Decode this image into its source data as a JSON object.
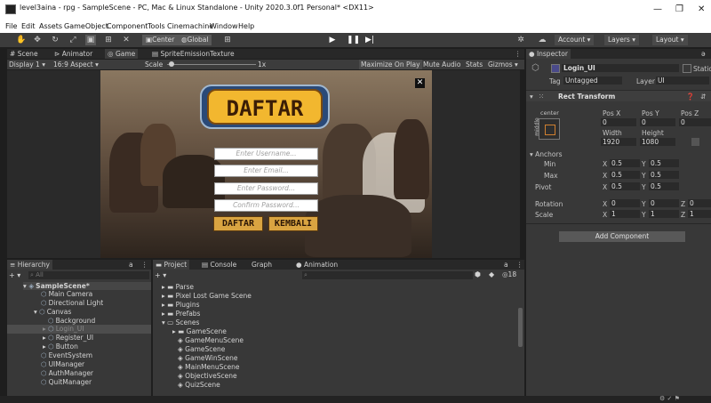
{
  "window": {
    "title": "level3aina - rpg - SampleScene - PC, Mac & Linux Standalone - Unity 2020.3.0f1 Personal* <DX11>",
    "minimize": "—",
    "maximize": "❐",
    "close": "✕"
  },
  "menu": [
    "File",
    "Edit",
    "Assets",
    "GameObject",
    "Component",
    "Tools",
    "Cinemachine",
    "Window",
    "Help"
  ],
  "toolbar": {
    "center_label": "Center",
    "global_label": "Global",
    "account_label": "Account",
    "layers_label": "Layers",
    "layout_label": "Layout"
  },
  "scene_tabs": {
    "scene": "Scene",
    "animator": "Animator",
    "game": "Game",
    "sprite_emission": "SpriteEmissionTexture"
  },
  "game_bar": {
    "display": "Display 1",
    "aspect": "16:9 Aspect",
    "scale_label": "Scale",
    "scale_value": "1x",
    "maximize": "Maximize On Play",
    "mute": "Mute Audio",
    "stats": "Stats",
    "gizmos": "Gizmos"
  },
  "game_ui": {
    "logo_text": "DAFTAR",
    "username_placeholder": "Enter Username...",
    "email_placeholder": "Enter Email...",
    "password_placeholder": "Enter Password...",
    "confirm_placeholder": "Confirm Password...",
    "daftar_button": "DAFTAR",
    "kembali_button": "KEMBALI",
    "close_glyph": "✕"
  },
  "inspector": {
    "tab": "Inspector",
    "object_name": "Login_UI",
    "static_label": "Static",
    "tag_label": "Tag",
    "tag_value": "Untagged",
    "layer_label": "Layer",
    "layer_value": "UI",
    "component_title": "Rect Transform",
    "anchor_h": "center",
    "anchor_v": "middle",
    "posx_label": "Pos X",
    "posy_label": "Pos Y",
    "posz_label": "Pos Z",
    "posx": "0",
    "posy": "0",
    "posz": "0",
    "width_label": "Width",
    "height_label": "Height",
    "width": "1920",
    "height": "1080",
    "anchors_label": "Anchors",
    "min_label": "Min",
    "max_label": "Max",
    "pivot_label": "Pivot",
    "min_x": "0.5",
    "min_y": "0.5",
    "max_x": "0.5",
    "max_y": "0.5",
    "pivot_x": "0.5",
    "pivot_y": "0.5",
    "rotation_label": "Rotation",
    "scale_label": "Scale",
    "rot_x": "0",
    "rot_y": "0",
    "rot_z": "0",
    "scale_x": "1",
    "scale_y": "1",
    "scale_z": "1",
    "add_component": "Add Component"
  },
  "hierarchy": {
    "tab": "Hierarchy",
    "search_placeholder": "All",
    "items": [
      "SampleScene*",
      "Main Camera",
      "Directional Light",
      "Canvas",
      "Background",
      "Login_UI",
      "Register_UI",
      "Button",
      "EventSystem",
      "UIManager",
      "AuthManager",
      "QuitManager"
    ]
  },
  "project": {
    "tabs": [
      "Project",
      "Console",
      "Graph",
      "Animation"
    ],
    "count": "18",
    "items": [
      "Parse",
      "Pixel Lost Game Scene",
      "Plugins",
      "Prefabs",
      "Scenes",
      "GameScene",
      "GameMenuScene",
      "GameScene",
      "GameWinScene",
      "MainMenuScene",
      "ObjectiveScene",
      "QuizScene"
    ]
  }
}
